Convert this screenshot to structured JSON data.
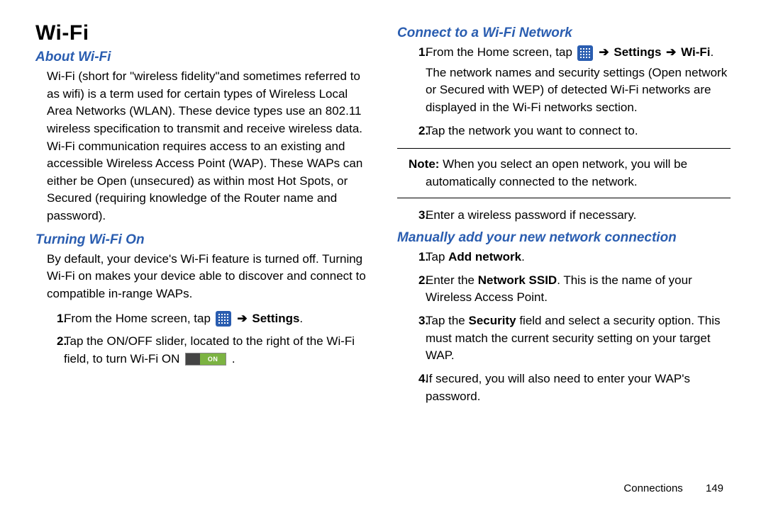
{
  "page": {
    "title": "Wi-Fi",
    "footer_section": "Connections",
    "footer_page": "149"
  },
  "left": {
    "about_heading": "About Wi-Fi",
    "about_body": "Wi-Fi (short for \"wireless fidelity\"and sometimes referred to as wifi) is a term used for certain types of Wireless Local Area Networks (WLAN). These device types use an 802.11 wireless specification to transmit and receive wireless data. Wi-Fi communication requires access to an existing and accessible Wireless Access Point (WAP). These WAPs can either be Open (unsecured) as within most Hot Spots, or Secured (requiring knowledge of the Router name and password).",
    "turning_heading": "Turning Wi-Fi On",
    "turning_body": "By default, your device's Wi-Fi feature is turned off. Turning Wi-Fi on makes your device able to discover and connect to compatible in-range WAPs.",
    "step1_pre": "From the Home screen, tap ",
    "step1_arrow": "➔",
    "step1_settings": " Settings",
    "step2_a": "Tap the ON/OFF slider, located to the right of the Wi-Fi field, to turn Wi-Fi ON ",
    "on_label": "ON"
  },
  "right": {
    "connect_heading": "Connect to a Wi-Fi Network",
    "c_step1_pre": "From the Home screen, tap ",
    "c_step1_arrow": "➔",
    "c_step1_settings": " Settings ",
    "c_step1_arrow2": "➔",
    "c_step1_wifi": " Wi-Fi",
    "c_step1_body": "The network names and security settings (Open network or Secured with WEP) of detected Wi-Fi networks are displayed in the Wi-Fi networks section.",
    "c_step2": "Tap the network you want to connect to.",
    "note_label": "Note:",
    "note_body1": " When you select an open network, you will be",
    "note_body2": "automatically connected to the network.",
    "c_step3": "Enter a wireless password if necessary.",
    "manual_heading": "Manually add your new network connection",
    "m1_pre": " Tap ",
    "m1_b": "Add network",
    "m2_pre": " Enter the ",
    "m2_b": "Network SSID",
    "m2_post": ". This is the name of your Wireless Access Point.",
    "m3_pre": " Tap the ",
    "m3_b": "Security",
    "m3_post": " field and select a security option. This must match the current security setting on your target WAP.",
    "m4": " If secured, you will also need to enter your WAP's password."
  },
  "nums": {
    "n1": "1.",
    "n2": "2.",
    "n3": "3.",
    "n4": "4."
  }
}
